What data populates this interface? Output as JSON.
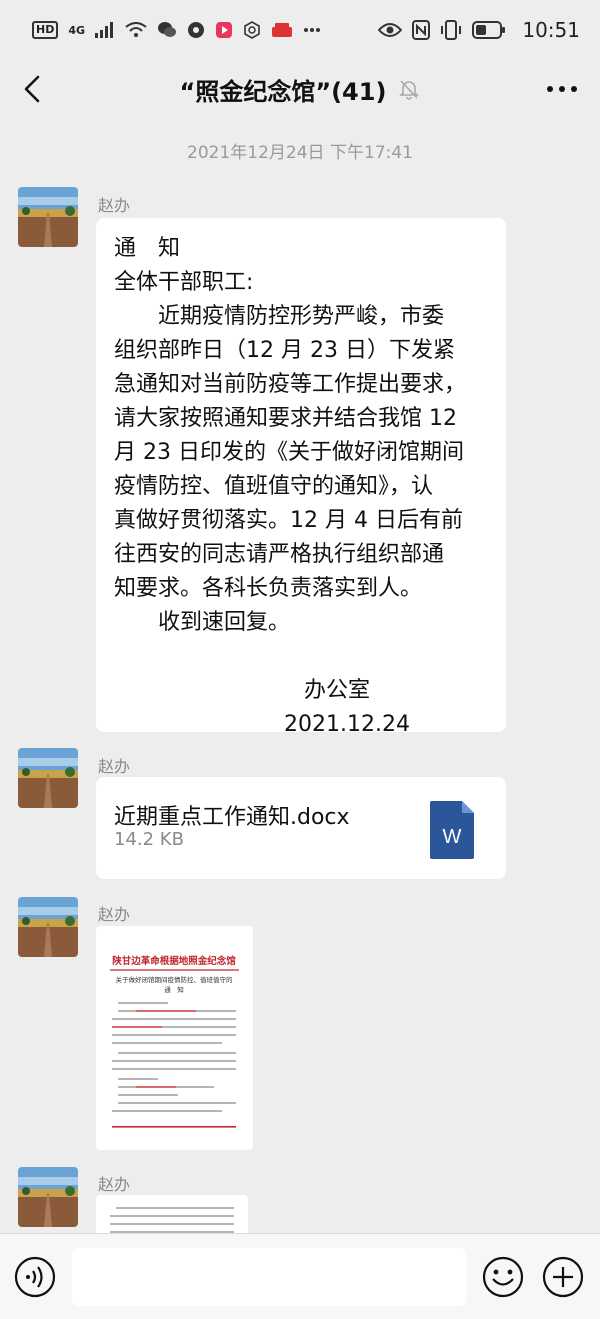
{
  "status_bar": {
    "left_badges": [
      "HD",
      "4G"
    ],
    "time": "10:51",
    "icons": [
      "signal-icon",
      "wifi-icon",
      "wechat-icon",
      "browser-icon",
      "video-icon",
      "app-icon",
      "app-icon",
      "more-dots-icon",
      "eye-icon",
      "nfc-icon",
      "vibrate-icon",
      "battery-icon"
    ]
  },
  "header": {
    "title": "“照金纪念馆”(41)",
    "icons": [
      "back-icon",
      "mute-bell-icon",
      "more-icon"
    ]
  },
  "timestamp": "2021年12月24日 下午17:41",
  "messages": [
    {
      "sender": "赵办",
      "type": "text",
      "lines": [
        "通　知",
        "全体干部职工:",
        "　　近期疫情防控形势严峻，市委",
        "组织部昨日（12 月 23 日）下发紧",
        "急通知对当前防疫等工作提出要求，",
        "请大家按照通知要求并结合我馆 12",
        "月 23 日印发的《关于做好闭馆期间",
        "疫情防控、值班值守的通知》，认",
        "真做好贯彻落实。12 月 4 日后有前",
        "往西安的同志请严格执行组织部通",
        "知要求。各科长负责落实到人。",
        "　　收到速回复。"
      ],
      "sign_office": "办公室",
      "sign_date": "2021.12.24"
    },
    {
      "sender": "赵办",
      "type": "file",
      "file_name": "近期重点工作通知.docx",
      "file_size": "14.2 KB",
      "file_icon_letter": "W"
    },
    {
      "sender": "赵办",
      "type": "image",
      "doc_title": "陕甘边革命根据地照金纪念馆",
      "doc_subtitle": "关于做好闭馆期间疫情防控、值班值守的",
      "doc_heading": "通　知"
    },
    {
      "sender": "赵办",
      "type": "image"
    }
  ],
  "colors": {
    "background": "#ededed",
    "bubble": "#ffffff",
    "word_blue": "#2b579a",
    "doc_red": "#c0272d"
  }
}
